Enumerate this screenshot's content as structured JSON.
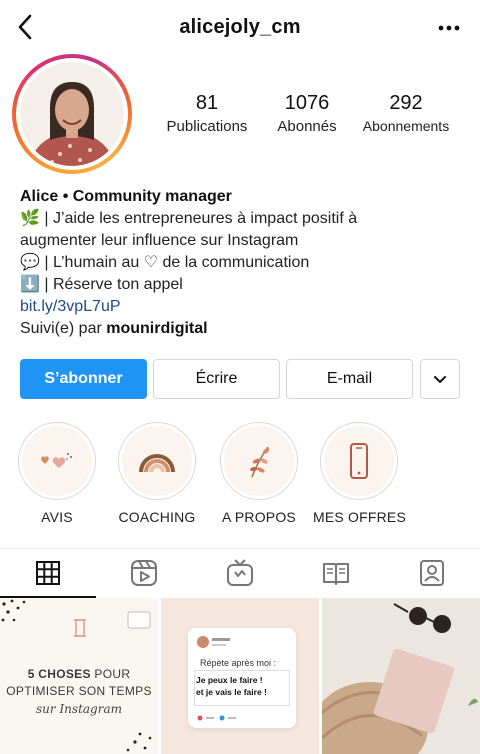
{
  "header": {
    "username": "alicejoly_cm",
    "back_icon": "chevron-left-icon",
    "more_icon": "more-horizontal-icon"
  },
  "stats": [
    {
      "value": "81",
      "label": "Publications"
    },
    {
      "value": "1076",
      "label": "Abonnés"
    },
    {
      "value": "292",
      "label": "Abonnements"
    }
  ],
  "bio": {
    "name": "Alice • Community manager",
    "line1": "🌿 | J’aide les entrepreneures à impact positif à",
    "line2": "augmenter leur influence sur Instagram",
    "line3": "💬 | L’humain au ♡ de la communication",
    "line4": "⬇️ | Réserve ton appel",
    "link": "bit.ly/3vpL7uP",
    "followed_prefix": "Suivi(e) par ",
    "followed_by": "mounirdigital"
  },
  "actions": {
    "follow_label": "S’abonner",
    "message_label": "Écrire",
    "email_label": "E-mail",
    "dropdown_icon": "chevron-down-icon"
  },
  "highlights": [
    {
      "label": "AVIS",
      "icon": "hearts-icon"
    },
    {
      "label": "COACHING",
      "icon": "rainbow-icon"
    },
    {
      "label": "A PROPOS",
      "icon": "leaf-branch-icon"
    },
    {
      "label": "MES OFFRES",
      "icon": "phone-icon"
    }
  ],
  "tabs": [
    {
      "icon": "grid-icon",
      "active": true
    },
    {
      "icon": "reels-icon",
      "active": false
    },
    {
      "icon": "igtv-icon",
      "active": false
    },
    {
      "icon": "guides-icon",
      "active": false
    },
    {
      "icon": "tagged-icon",
      "active": false
    }
  ],
  "posts": {
    "post1": {
      "line1_bold": "5 CHOSES",
      "line1_rest": " POUR",
      "line2": "OPTIMISER SON TEMPS",
      "script": "sur Instagram"
    },
    "post2": {
      "repeat": "Répète après moi :",
      "strong1": "Je peux le faire !",
      "strong2": "et je vais le faire !"
    }
  },
  "colors": {
    "follow_button": "#1e94f5",
    "link": "#1e4a8b",
    "ring_start": "#f9a13a",
    "ring_end": "#c13584"
  }
}
